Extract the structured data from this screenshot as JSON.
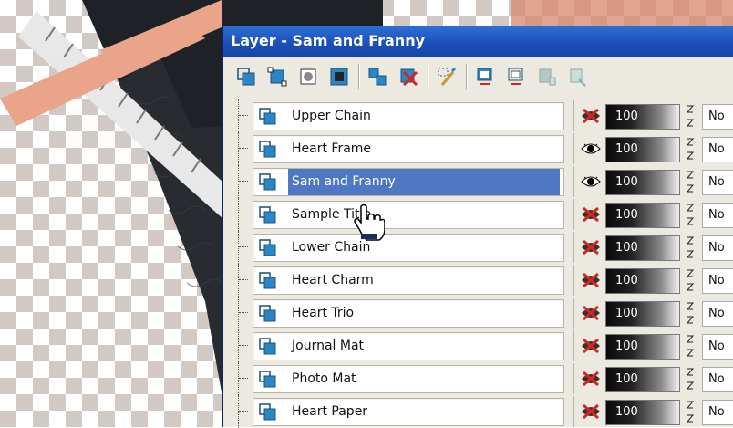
{
  "window": {
    "title": "Layer - Sam and Franny"
  },
  "toolbar": {
    "buttons": [
      {
        "name": "new-raster-layer-icon",
        "color": "#2a87c6"
      },
      {
        "name": "new-vector-layer-icon",
        "color": "#2a87c6"
      },
      {
        "name": "new-mask-layer-icon",
        "color": "#2a87c6"
      },
      {
        "name": "new-adjustment-layer-icon",
        "color": "#2a87c6"
      },
      {
        "name": "duplicate-layer-icon",
        "color": "#2a87c6"
      },
      {
        "name": "delete-layer-icon",
        "color": "#d6261f"
      },
      {
        "name": "edit-selection-icon",
        "color": "#2a87c6"
      },
      {
        "name": "show-all-layers-icon",
        "color": "#2a87c6"
      },
      {
        "name": "hide-all-layers-icon",
        "color": "#2a87c6"
      },
      {
        "name": "link-layers-icon",
        "color": "#8aa"
      },
      {
        "name": "unlink-layers-icon",
        "color": "#8aa"
      }
    ]
  },
  "layers": [
    {
      "name": "Upper Chain",
      "visible": false,
      "opacity": "100",
      "blend": "No",
      "selected": false
    },
    {
      "name": "Heart Frame",
      "visible": true,
      "opacity": "100",
      "blend": "No",
      "selected": false
    },
    {
      "name": "Sam and Franny",
      "visible": true,
      "opacity": "100",
      "blend": "No",
      "selected": true
    },
    {
      "name": "Sample Title",
      "visible": false,
      "opacity": "100",
      "blend": "No",
      "selected": false
    },
    {
      "name": "Lower Chain",
      "visible": false,
      "opacity": "100",
      "blend": "No",
      "selected": false
    },
    {
      "name": "Heart Charm",
      "visible": false,
      "opacity": "100",
      "blend": "No",
      "selected": false
    },
    {
      "name": "Heart Trio",
      "visible": false,
      "opacity": "100",
      "blend": "No",
      "selected": false
    },
    {
      "name": "Journal Mat",
      "visible": false,
      "opacity": "100",
      "blend": "No",
      "selected": false
    },
    {
      "name": "Photo Mat",
      "visible": false,
      "opacity": "100",
      "blend": "No",
      "selected": false
    },
    {
      "name": "Heart Paper",
      "visible": false,
      "opacity": "100",
      "blend": "No",
      "selected": false
    }
  ],
  "colors": {
    "titlebar": "#1a4fb8",
    "selection": "#4e77c4",
    "hidden_mark": "#d6261f"
  }
}
